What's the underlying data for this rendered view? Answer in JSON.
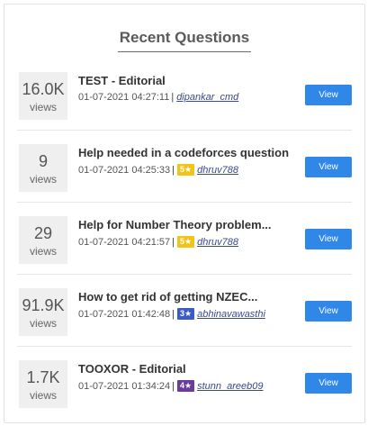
{
  "heading": "Recent Questions",
  "views_label": "views",
  "view_button_label": "View",
  "questions": [
    {
      "views": "16.0K",
      "title": "TEST - Editorial",
      "time": "01-07-2021 04:27:11",
      "stars": "",
      "star_color": "",
      "user": "dipankar_cmd"
    },
    {
      "views": "9",
      "title": "Help needed in a codeforces question",
      "time": "01-07-2021 04:25:33",
      "stars": "5★",
      "star_color": "#f0c419",
      "user": "dhruv788"
    },
    {
      "views": "29",
      "title": "Help for Number Theory problem...",
      "time": "01-07-2021 04:21:57",
      "stars": "5★",
      "star_color": "#f0c419",
      "user": "dhruv788"
    },
    {
      "views": "91.9K",
      "title": "How to get rid of getting NZEC...",
      "time": "01-07-2021 01:42:48",
      "stars": "3★",
      "star_color": "#3b5bc7",
      "user": "abhinavawasthi"
    },
    {
      "views": "1.7K",
      "title": "TOOXOR - Editorial",
      "time": "01-07-2021 01:34:24",
      "stars": "4★",
      "star_color": "#6a3d9a",
      "user": "stunn_areeb09"
    }
  ]
}
